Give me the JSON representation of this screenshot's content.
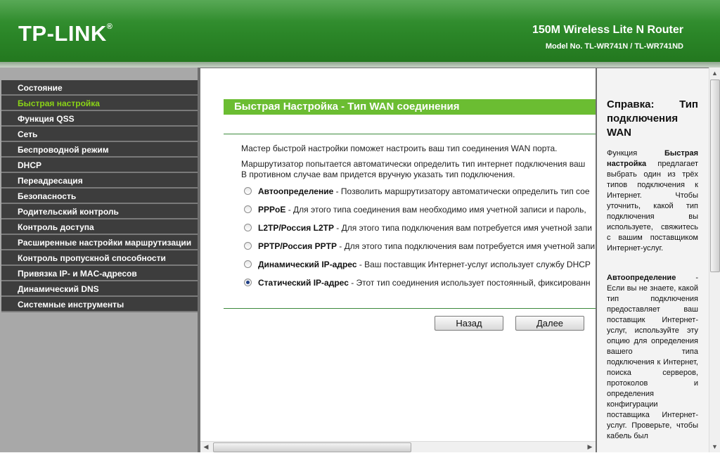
{
  "header": {
    "logo": "TP-LINK",
    "logo_mark": "®",
    "product": "150M Wireless Lite N Router",
    "model": "Model No. TL-WR741N / TL-WR741ND"
  },
  "sidebar": {
    "items": [
      {
        "label": "Состояние",
        "active": false
      },
      {
        "label": "Быстрая настройка",
        "active": true
      },
      {
        "label": "Функция QSS",
        "active": false
      },
      {
        "label": "Сеть",
        "active": false
      },
      {
        "label": "Беспроводной режим",
        "active": false
      },
      {
        "label": "DHCP",
        "active": false
      },
      {
        "label": "Переадресация",
        "active": false
      },
      {
        "label": "Безопасность",
        "active": false
      },
      {
        "label": "Родительский контроль",
        "active": false
      },
      {
        "label": "Контроль доступа",
        "active": false
      },
      {
        "label": "Расширенные настройки маршрутизации",
        "active": false
      },
      {
        "label": "Контроль пропускной способности",
        "active": false
      },
      {
        "label": "Привязка IP- и MAC-адресов",
        "active": false
      },
      {
        "label": "Динамический DNS",
        "active": false
      },
      {
        "label": "Системные инструменты",
        "active": false
      }
    ],
    "active_color": "#8ad317"
  },
  "main": {
    "title": "Быстрая Настройка - Тип WAN соединения",
    "intro1": "Мастер быстрой настройки поможет настроить ваш тип соединения WAN порта.",
    "intro2a": "Маршрутизатор попытается автоматически определить тип интернет подключения ваш",
    "intro2b": "В противном случае вам придется вручную указать тип подключения.",
    "options": [
      {
        "name": "Автоопределение",
        "desc": " - Позволить маршрутизатору автоматически определить тип сое",
        "checked": false
      },
      {
        "name": "PPPoE",
        "desc": " - Для этого типа соединения вам необходимо имя учетной записи и пароль,",
        "checked": false
      },
      {
        "name": "L2TP/Россия L2TP",
        "desc": " - Для этого типа подключения вам потребуется имя учетной запи",
        "checked": false
      },
      {
        "name": "PPTP/Россия PPTP",
        "desc": " - Для этого типа подключения вам потребуется имя учетной запи",
        "checked": false
      },
      {
        "name": "Динамический IP-адрес",
        "desc": " - Ваш поставщик Интернет-услуг использует службу DHCP",
        "checked": false
      },
      {
        "name": "Статический IP-адрес",
        "desc": " - Этот тип соединения использует постоянный, фиксированн",
        "checked": true
      }
    ],
    "back_label": "Назад",
    "next_label": "Далее"
  },
  "help": {
    "title": "Справка: Тип подключения WAN",
    "p1_pre": "Функция ",
    "p1_bold": "Быстрая настройка",
    "p1_post": " предлагает выбрать один из трёх типов подключения к Интернет. Чтобы уточнить, какой тип подключения вы используете, свяжитесь с вашим поставщиком Интернет-услуг.",
    "p2_bold": "Автоопределение",
    "p2_post": " - Если вы не знаете, какой тип подключения предоставляет ваш поставщик Интернет-услуг, используйте эту опцию для определения вашего типа подключения к Интернет, поиска серверов, протоколов и определения конфигурации поставщика Интернет-услуг. Проверьте, чтобы кабель был"
  },
  "colors": {
    "header_green": "#2b8628",
    "title_green": "#6bbd32",
    "nav_bg": "#3d3d3d"
  }
}
